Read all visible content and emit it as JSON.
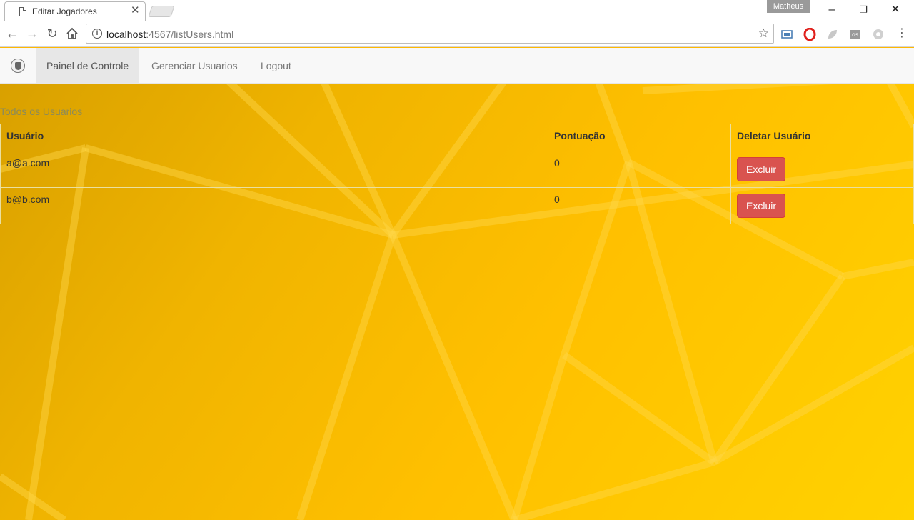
{
  "browser": {
    "tab_title": "Editar Jogadores",
    "profile_name": "Matheus",
    "url_host": "localhost",
    "url_rest": ":4567/listUsers.html"
  },
  "navbar": {
    "items": [
      {
        "label": "Painel de Controle",
        "active": true
      },
      {
        "label": "Gerenciar Usuarios",
        "active": false
      },
      {
        "label": "Logout",
        "active": false
      }
    ]
  },
  "main": {
    "section_title": "Todos os Usuarios",
    "table": {
      "headers": [
        "Usuário",
        "Pontuação",
        "Deletar Usuário"
      ],
      "rows": [
        {
          "user": "a@a.com",
          "score": "0",
          "action": "Excluir"
        },
        {
          "user": "b@b.com",
          "score": "0",
          "action": "Excluir"
        }
      ]
    }
  },
  "colors": {
    "accent_danger": "#d9534f",
    "background": "#ffc000"
  }
}
